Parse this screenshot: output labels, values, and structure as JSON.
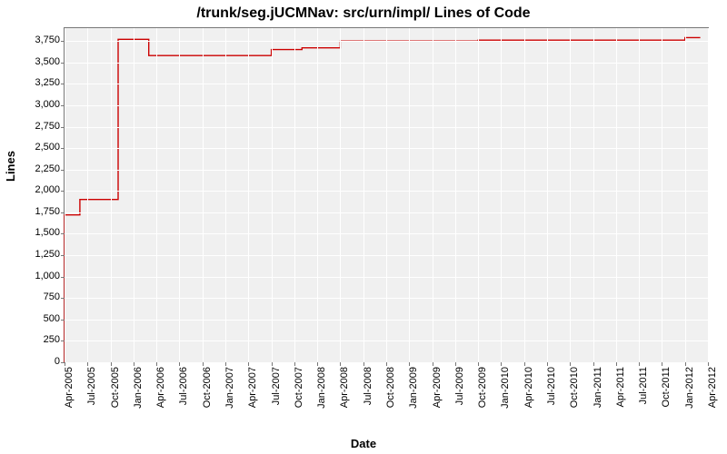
{
  "chart_data": {
    "type": "line",
    "title": "/trunk/seg.jUCMNav: src/urn/impl/ Lines of Code",
    "xlabel": "Date",
    "ylabel": "Lines",
    "ylim": [
      0,
      3900
    ],
    "y_ticks": [
      0,
      250,
      500,
      750,
      1000,
      1250,
      1500,
      1750,
      2000,
      2250,
      2500,
      2750,
      3000,
      3250,
      3500,
      3750
    ],
    "x_ticks": [
      "Apr-2005",
      "Jul-2005",
      "Oct-2005",
      "Jan-2006",
      "Apr-2006",
      "Jul-2006",
      "Oct-2006",
      "Jan-2007",
      "Apr-2007",
      "Jul-2007",
      "Oct-2007",
      "Jan-2008",
      "Apr-2008",
      "Jul-2008",
      "Oct-2008",
      "Jan-2009",
      "Apr-2009",
      "Jul-2009",
      "Oct-2009",
      "Jan-2010",
      "Apr-2010",
      "Jul-2010",
      "Oct-2010",
      "Jan-2011",
      "Apr-2011",
      "Jul-2011",
      "Oct-2011",
      "Jan-2012",
      "Apr-2012"
    ],
    "series": [
      {
        "name": "Lines of Code",
        "color": "#cc0000",
        "points": [
          {
            "x": "Apr-2005",
            "y": 0
          },
          {
            "x": "Apr-2005",
            "y": 1720
          },
          {
            "x": "Jun-2005",
            "y": 1720
          },
          {
            "x": "Jun-2005",
            "y": 1900
          },
          {
            "x": "Nov-2005",
            "y": 1900
          },
          {
            "x": "Nov-2005",
            "y": 3770
          },
          {
            "x": "Mar-2006",
            "y": 3770
          },
          {
            "x": "Mar-2006",
            "y": 3580
          },
          {
            "x": "Jul-2007",
            "y": 3580
          },
          {
            "x": "Jul-2007",
            "y": 3650
          },
          {
            "x": "Nov-2007",
            "y": 3650
          },
          {
            "x": "Nov-2007",
            "y": 3670
          },
          {
            "x": "Apr-2008",
            "y": 3670
          },
          {
            "x": "Apr-2008",
            "y": 3750
          },
          {
            "x": "Oct-2009",
            "y": 3750
          },
          {
            "x": "Oct-2009",
            "y": 3760
          },
          {
            "x": "Jan-2012",
            "y": 3760
          },
          {
            "x": "Jan-2012",
            "y": 3790
          },
          {
            "x": "Mar-2012",
            "y": 3790
          }
        ]
      }
    ]
  }
}
